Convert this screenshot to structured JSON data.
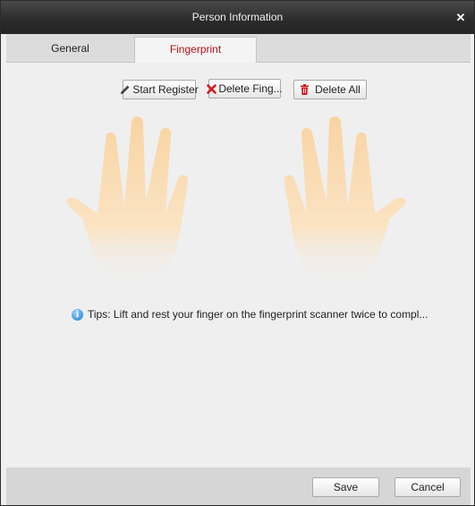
{
  "window": {
    "title": "Person Information",
    "close_symbol": "✕"
  },
  "tabs": [
    {
      "label": "General",
      "active": false
    },
    {
      "label": "Fingerprint",
      "active": true
    }
  ],
  "toolbar": {
    "start_register": "Start Register",
    "delete_fingerprint": "Delete Fing...",
    "delete_all": "Delete All"
  },
  "tips": {
    "text": "Tips: Lift and rest your finger on the fingerprint scanner twice to compl..."
  },
  "footer": {
    "save": "Save",
    "cancel": "Cancel"
  },
  "colors": {
    "active_tab_text": "#b0121b",
    "hand": "#f9d9ad",
    "title_bar": "#2f2f2f"
  },
  "icons": {
    "start_register": "pencil-icon",
    "delete_fingerprint": "red-x-icon",
    "delete_all": "trash-icon",
    "tips": "info-icon"
  }
}
